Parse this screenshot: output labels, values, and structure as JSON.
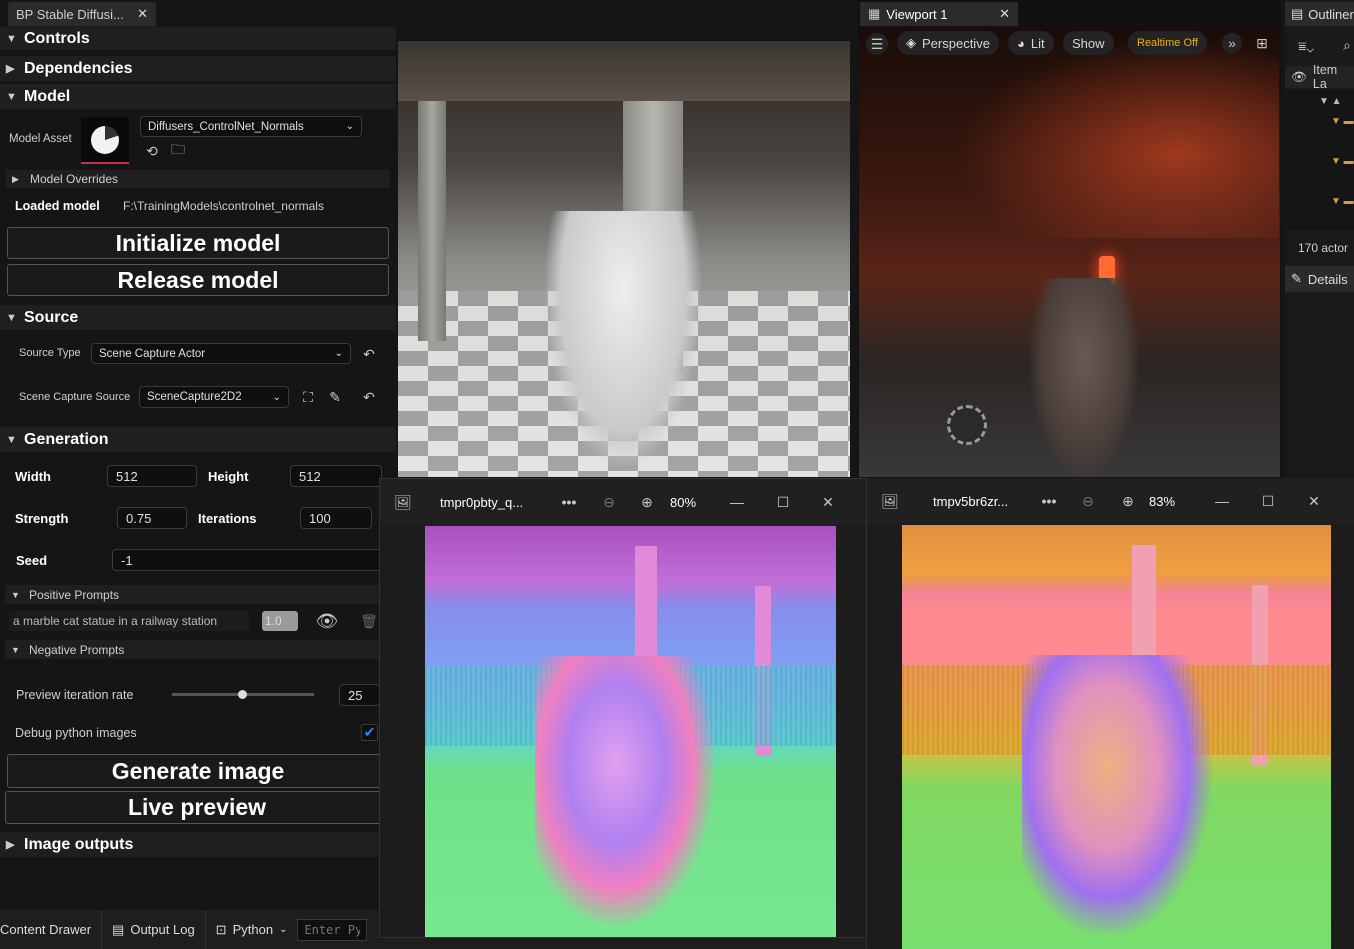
{
  "left_tab": {
    "title": "BP Stable Diffusi..."
  },
  "controls": {
    "title": "Controls",
    "dependencies": "Dependencies",
    "model": {
      "title": "Model",
      "asset_label": "Model Asset",
      "asset_value": "Diffusers_ControlNet_Normals",
      "overrides": "Model Overrides",
      "loaded_label": "Loaded model",
      "loaded_value": "F:\\TrainingModels\\controlnet_normals",
      "init_button": "Initialize model",
      "release_button": "Release model"
    },
    "source": {
      "title": "Source",
      "type_label": "Source Type",
      "type_value": "Scene Capture Actor",
      "capture_label": "Scene Capture Source",
      "capture_value": "SceneCapture2D2"
    },
    "generation": {
      "title": "Generation",
      "width_label": "Width",
      "width_value": "512",
      "height_label": "Height",
      "height_value": "512",
      "strength_label": "Strength",
      "strength_value": "0.75",
      "iterations_label": "Iterations",
      "iterations_value": "100",
      "seed_label": "Seed",
      "seed_value": "-1",
      "positive_label": "Positive Prompts",
      "positive_prompt": "a marble cat statue in a railway station",
      "positive_weight": "1.0",
      "negative_label": "Negative Prompts",
      "preview_rate_label": "Preview iteration rate",
      "preview_rate_value": "25",
      "preview_rate_fraction": 0.49,
      "debug_label": "Debug python images",
      "debug_checked": true,
      "generate_button": "Generate image",
      "live_button": "Live preview"
    },
    "image_outputs": "Image outputs"
  },
  "viewport": {
    "tab_title": "Viewport 1",
    "perspective": "Perspective",
    "lit": "Lit",
    "show": "Show",
    "realtime": "Realtime Off"
  },
  "outliner": {
    "title": "Outliner",
    "item_label": "Item La",
    "actor_count": "170 actor",
    "details": "Details"
  },
  "image_window_1": {
    "title": "tmpr0pbty_q...",
    "zoom": "80%"
  },
  "image_window_2": {
    "title": "tmpv5br6zr...",
    "zoom": "83%"
  },
  "bottom_bar": {
    "content_drawer": "Content Drawer",
    "output_log": "Output Log",
    "python": "Python",
    "console_placeholder": "Enter Pyt"
  },
  "colors": {
    "accent_orange": "#f0b000",
    "check_blue": "#1a73e8",
    "panel_bg": "#151515",
    "section_bg": "#1f1f1f"
  }
}
